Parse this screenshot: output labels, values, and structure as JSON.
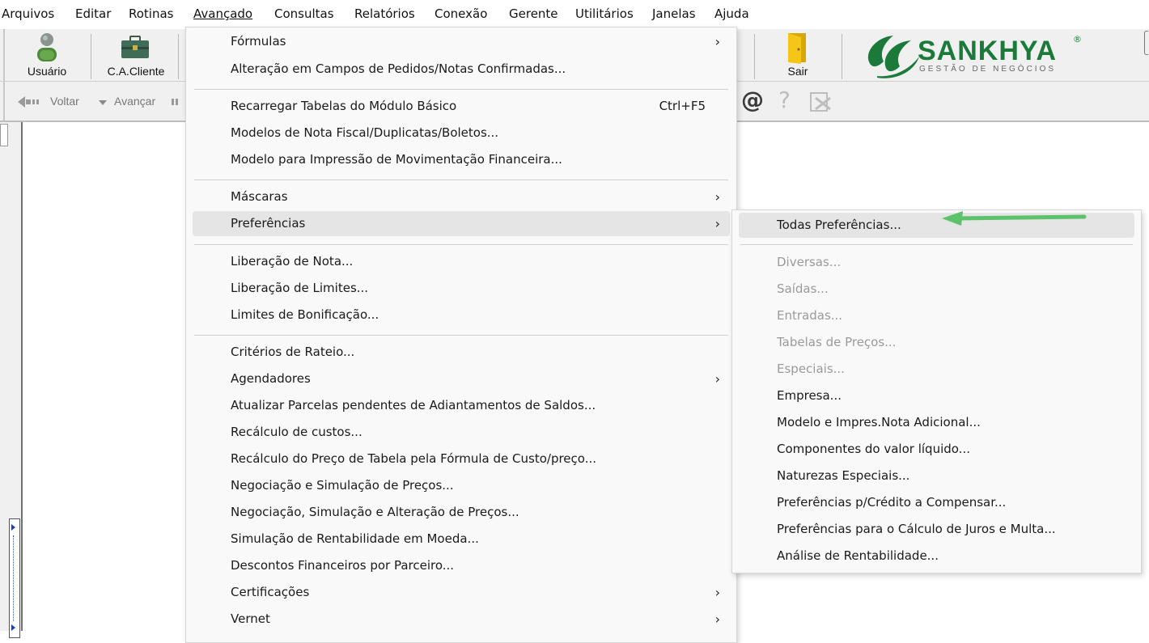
{
  "menubar": {
    "items": [
      "Arquivos",
      "Editar",
      "Rotinas",
      "Avançado",
      "Consultas",
      "Relatórios",
      "Conexão",
      "Gerente",
      "Utilitários",
      "Janelas",
      "Ajuda"
    ],
    "active_index": 3
  },
  "toolbar": {
    "usuario_label": "Usuário",
    "cacliente_label": "C.A.Cliente",
    "sair_label": "Sair"
  },
  "navbar": {
    "voltar_label": "Voltar",
    "avancar_label": "Avançar"
  },
  "logo": {
    "brand": "SANKHYA",
    "tagline": "GESTÃO DE NEGÓCIOS",
    "registered": "®",
    "brand_color": "#1b7a3a"
  },
  "menu_avancado": {
    "items": [
      {
        "label": "Fórmulas",
        "submenu": true
      },
      {
        "label": "Alteração em Campos de Pedidos/Notas Confirmadas..."
      },
      {
        "label": "Recarregar Tabelas do Módulo Básico",
        "shortcut": "Ctrl+F5"
      },
      {
        "label": "Modelos de Nota Fiscal/Duplicatas/Boletos..."
      },
      {
        "label": "Modelo para Impressão de Movimentação Financeira..."
      },
      {
        "label": "Máscaras",
        "submenu": true
      },
      {
        "label": "Preferências",
        "submenu": true,
        "highlighted": true
      },
      {
        "label": "Liberação de Nota..."
      },
      {
        "label": "Liberação de Limites..."
      },
      {
        "label": "Limites de Bonificação..."
      },
      {
        "label": "Critérios de Rateio..."
      },
      {
        "label": "Agendadores",
        "submenu": true
      },
      {
        "label": "Atualizar Parcelas pendentes de Adiantamentos de Saldos..."
      },
      {
        "label": "Recálculo de custos..."
      },
      {
        "label": "Recálculo do Preço de Tabela pela Fórmula de Custo/preço..."
      },
      {
        "label": "Negociação e Simulação de Preços..."
      },
      {
        "label": "Negociação, Simulação e Alteração de Preços..."
      },
      {
        "label": "Simulação de Rentabilidade em Moeda..."
      },
      {
        "label": "Descontos Financeiros por Parceiro..."
      },
      {
        "label": "Certificações",
        "submenu": true
      },
      {
        "label": "Vernet",
        "submenu": true
      }
    ]
  },
  "menu_preferencias": {
    "items": [
      {
        "label": "Todas Preferências...",
        "highlighted": true
      },
      {
        "label": "Diversas...",
        "disabled": true
      },
      {
        "label": "Saídas...",
        "disabled": true
      },
      {
        "label": "Entradas...",
        "disabled": true
      },
      {
        "label": "Tabelas de Preços...",
        "disabled": true
      },
      {
        "label": "Especiais...",
        "disabled": true
      },
      {
        "label": "Empresa..."
      },
      {
        "label": "Modelo e Impres.Nota Adicional..."
      },
      {
        "label": "Componentes do valor líquido..."
      },
      {
        "label": "Naturezas Especiais..."
      },
      {
        "label": "Preferências p/Crédito a Compensar..."
      },
      {
        "label": "Preferências para o Cálculo de Juros e Multa..."
      },
      {
        "label": "Análise de Rentabilidade..."
      }
    ]
  },
  "annotation": {
    "arrow_color": "#5cc36a"
  }
}
